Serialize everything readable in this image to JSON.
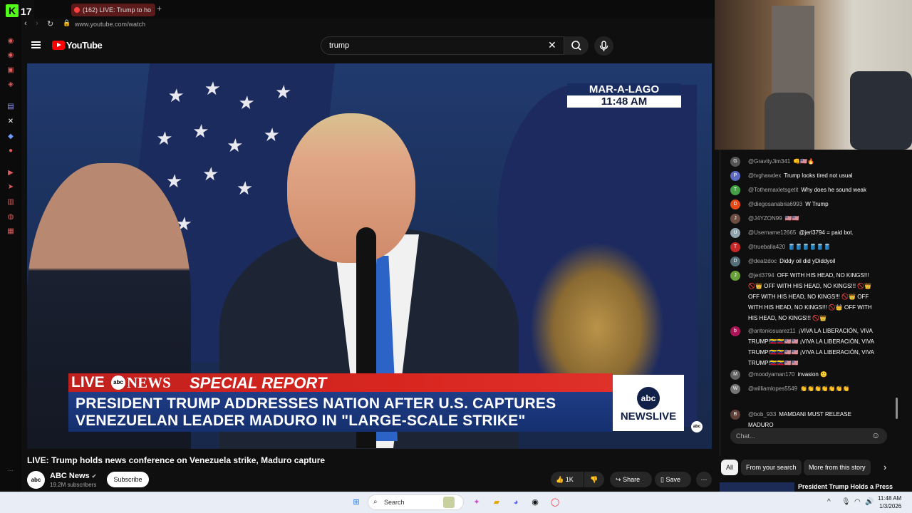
{
  "rail": {
    "count": "17",
    "logo": "K"
  },
  "browser": {
    "tab_title": "(162) LIVE: Trump to ho",
    "url": "www.youtube.com/watch"
  },
  "youtube": {
    "logo_text": "YouTube",
    "search_value": "trump"
  },
  "video": {
    "bug_top": "MAR-A-LAGO",
    "bug_bottom": "11:48 AM",
    "live_label": "LIVE",
    "network": "NEWS",
    "special_report": "SPECIAL REPORT",
    "headline_line1": "PRESIDENT TRUMP ADDRESSES NATION AFTER U.S. CAPTURES",
    "headline_line2": "VENEZUELAN LEADER MADURO IN \"LARGE-SCALE STRIKE\"",
    "newslive_logo": "abc",
    "newslive_text": "NEWSLIVE",
    "corner_logo": "abc"
  },
  "info": {
    "title": "LIVE: Trump holds news conference on Venezuela strike, Maduro capture",
    "channel_name": "ABC News",
    "channel_avatar": "abc",
    "subscribers": "19.2M subscribers",
    "subscribe_label": "Subscribe",
    "likes": "1K",
    "share_label": "Share",
    "save_label": "Save"
  },
  "chat": {
    "messages": [
      {
        "avatar": "G",
        "avatar_color": "#555555",
        "author": "@GravityJim341",
        "text": "👊🇺🇸🔥"
      },
      {
        "avatar": "P",
        "avatar_color": "#5c6bc0",
        "author": "@tvghawdex",
        "text": "Trump looks tired not usual"
      },
      {
        "avatar": "T",
        "avatar_color": "#43a047",
        "author": "@Tothemaxletsgetit",
        "text": "Why does he sound weak"
      },
      {
        "avatar": "D",
        "avatar_color": "#e64a19",
        "author": "@diegosanabria6993",
        "text": "W Trump"
      },
      {
        "avatar": "J",
        "avatar_color": "#6d4c41",
        "author": "@J4YZON99",
        "text": "🇺🇸🇺🇸"
      },
      {
        "avatar": "U",
        "avatar_color": "#90a4ae",
        "author": "@Username12665",
        "text": "@jerl3794 = paid bot."
      },
      {
        "avatar": "T",
        "avatar_color": "#c62828",
        "author": "@trueballa420",
        "text": "🛢️🛢️🛢️🛢️🛢️🛢️"
      },
      {
        "avatar": "D",
        "avatar_color": "#546e7a",
        "author": "@dealzdoc",
        "text": "Diddy oil did yDiddyoil"
      },
      {
        "avatar": "J",
        "avatar_color": "#689f38",
        "author": "@jerl3794",
        "text": "OFF WITH HIS HEAD, NO KINGS!!! 🚫👑 OFF WITH HIS HEAD, NO KINGS!!! 🚫👑 OFF WITH HIS HEAD, NO KINGS!!! 🚫👑 OFF WITH HIS HEAD, NO KINGS!!! 🚫👑 OFF WITH HIS HEAD, NO KINGS!!! 🚫👑"
      },
      {
        "avatar": "b",
        "avatar_color": "#ad1457",
        "author": "@antoniosuarez11",
        "text": "¡VIVA LA LIBERACIÓN, VIVA TRUMP!🇻🇪🇻🇪🇺🇸🇺🇸 ¡VIVA LA LIBERACIÓN, VIVA TRUMP!🇻🇪🇻🇪🇺🇸🇺🇸 ¡VIVA LA LIBERACIÓN, VIVA TRUMP!🇻🇪🇻🇪🇺🇸🇺🇸"
      },
      {
        "avatar": "M",
        "avatar_color": "#616161",
        "author": "@moodyaman170",
        "text": "invasion 🙂"
      },
      {
        "avatar": "W",
        "avatar_color": "#757575",
        "author": "@williamlopes5549",
        "text": "👏👏👏👏👏👏👏"
      },
      {
        "avatar": "B",
        "avatar_color": "#5d4037",
        "author": "@bob_933",
        "text": "MAMDANI MUST RELEASE MADURO"
      }
    ],
    "input_placeholder": "Chat..."
  },
  "related": {
    "chips": [
      "All",
      "From your search",
      "More from this story"
    ],
    "rec_title": "President Trump Holds a Press"
  },
  "taskbar": {
    "search_placeholder": "Search",
    "time": "11:48 AM",
    "date": "1/3/2026"
  }
}
